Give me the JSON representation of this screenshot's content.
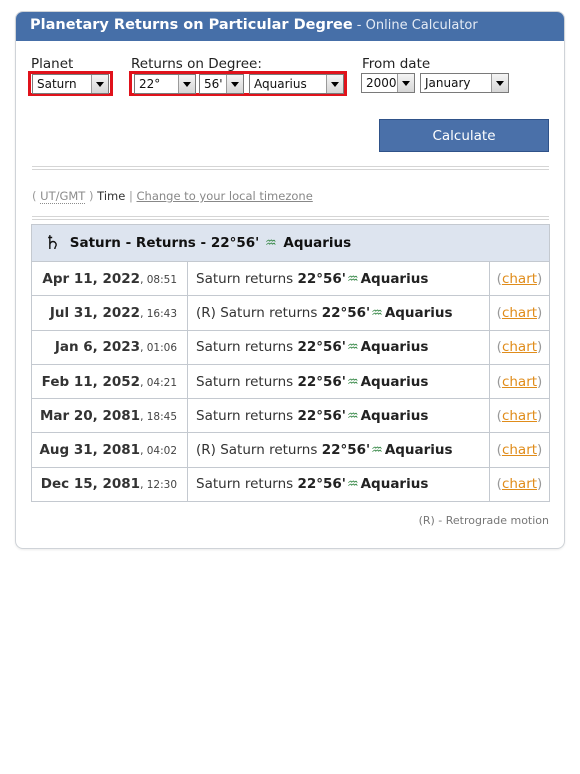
{
  "header": {
    "title": "Planetary Returns on Particular Degree",
    "separator": " - ",
    "subtitle": "Online Calculator"
  },
  "form": {
    "planet_label": "Planet",
    "planet_value": "Saturn",
    "returns_label": "Returns on Degree:",
    "degree_value": "22°",
    "minute_value": "56'",
    "sign_value": "Aquarius",
    "from_label": "From date",
    "year_value": "2000",
    "month_value": "January",
    "calculate_label": "Calculate"
  },
  "timezone": {
    "open": "(",
    "utgmt": "UT/GMT",
    "close": ")",
    "time": "Time",
    "pipe": "|",
    "link": "Change to your local timezone"
  },
  "results": {
    "saturn_symbol": "♄",
    "aquarius_symbol": "♒",
    "header_text": "Saturn - Returns - 22°56'",
    "header_sign": "Aquarius",
    "rows": [
      {
        "date": "Apr 11, 2022",
        "time": "08:51",
        "retro": "",
        "text": "Saturn returns",
        "deg": "22°56'",
        "sign": "Aquarius",
        "chart": "chart"
      },
      {
        "date": "Jul 31, 2022",
        "time": "16:43",
        "retro": "(R) ",
        "text": "Saturn returns",
        "deg": "22°56'",
        "sign": "Aquarius",
        "chart": "chart"
      },
      {
        "date": "Jan 6, 2023",
        "time": "01:06",
        "retro": "",
        "text": "Saturn returns",
        "deg": "22°56'",
        "sign": "Aquarius",
        "chart": "chart"
      },
      {
        "date": "Feb 11, 2052",
        "time": "04:21",
        "retro": "",
        "text": "Saturn returns",
        "deg": "22°56'",
        "sign": "Aquarius",
        "chart": "chart"
      },
      {
        "date": "Mar 20, 2081",
        "time": "18:45",
        "retro": "",
        "text": "Saturn returns",
        "deg": "22°56'",
        "sign": "Aquarius",
        "chart": "chart"
      },
      {
        "date": "Aug 31, 2081",
        "time": "04:02",
        "retro": "(R) ",
        "text": "Saturn returns",
        "deg": "22°56'",
        "sign": "Aquarius",
        "chart": "chart"
      },
      {
        "date": "Dec 15, 2081",
        "time": "12:30",
        "retro": "",
        "text": "Saturn returns",
        "deg": "22°56'",
        "sign": "Aquarius",
        "chart": "chart"
      }
    ],
    "footnote": "(R) - Retrograde motion"
  }
}
